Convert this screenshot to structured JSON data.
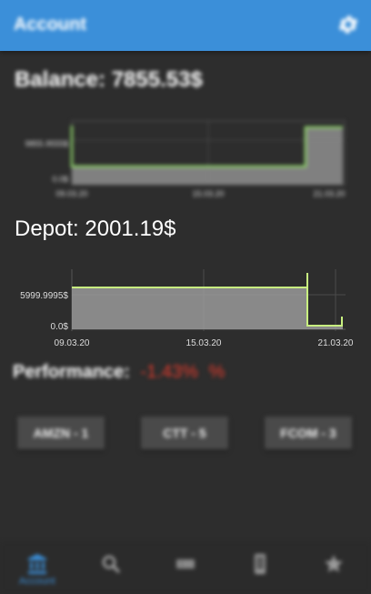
{
  "app": {
    "title": "Account",
    "accent": "#3b8fd9"
  },
  "balance": {
    "heading": "Balance: 7855.53$"
  },
  "balance_chart": {
    "chart_data": {
      "type": "area",
      "x_labels": [
        "09.03.20",
        "15.03.20",
        "21.03.20"
      ],
      "y_tick_labels": [
        "9855.9555$",
        "0.0$"
      ],
      "series": [
        {
          "values": [
            1400,
            1400,
            1400,
            9855.96,
            9855.96
          ]
        }
      ],
      "color": "#8ed36a"
    }
  },
  "depot": {
    "heading": "Depot: 2001.19$"
  },
  "depot_chart": {
    "chart_data": {
      "type": "area",
      "x_labels": [
        "09.03.20",
        "15.03.20",
        "21.03.20"
      ],
      "y_tick_labels": [
        "5999.9995$",
        "0.0$"
      ],
      "ylim": [
        0,
        7000
      ],
      "series": [
        {
          "values": [
            6000,
            6000,
            6000,
            6900,
            0,
            0,
            2001.19
          ]
        }
      ],
      "color": "#c8f080"
    }
  },
  "performance": {
    "label": "Performance:",
    "value": "-1.43%",
    "unit": "%"
  },
  "stocks": [
    "AMZN - 1",
    "CTT - 5",
    "FCOM - 3"
  ],
  "nav": {
    "items": [
      {
        "icon": "bank-icon",
        "label": "Account"
      },
      {
        "icon": "search-icon",
        "label": ""
      },
      {
        "icon": "ticket-icon",
        "label": ""
      },
      {
        "icon": "phone-icon",
        "label": ""
      },
      {
        "icon": "star-icon",
        "label": ""
      }
    ]
  }
}
